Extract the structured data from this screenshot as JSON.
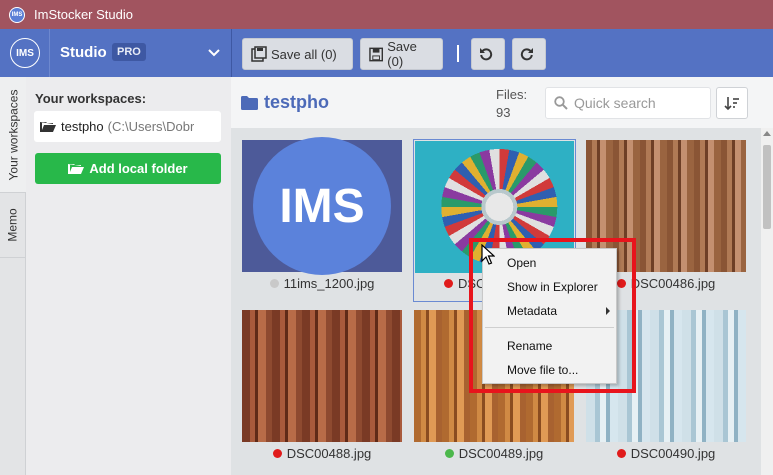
{
  "window": {
    "title": "ImStocker Studio",
    "logo_text": "IMS"
  },
  "header": {
    "logo_text": "IMS",
    "studio_label": "Studio",
    "pro_badge": "PRO",
    "save_all_label": "Save all (0)",
    "save_label": "Save (0)"
  },
  "vtabs": {
    "workspaces": "Your workspaces",
    "memo": "Memo"
  },
  "sidebar": {
    "heading": "Your workspaces:",
    "workspace": {
      "name": "testpho",
      "path": "(C:\\Users\\Dobr"
    },
    "add_folder_label": "Add local folder"
  },
  "main": {
    "folder_name": "testpho",
    "files_label": "Files:",
    "files_count": "93",
    "search_placeholder": "Quick search"
  },
  "tiles": [
    {
      "name": "11ims_1200.jpg",
      "dot": "#c9c9c9"
    },
    {
      "name": "DSC",
      "dot": "#e01b1b"
    },
    {
      "name": "DSC00486.jpg",
      "dot": "#e01b1b"
    },
    {
      "name": "DSC00488.jpg",
      "dot": "#e01b1b"
    },
    {
      "name": "DSC00489.jpg",
      "dot": "#4cb84c"
    },
    {
      "name": "DSC00490.jpg",
      "dot": "#e01b1b"
    }
  ],
  "context_menu": {
    "open": "Open",
    "show_in_explorer": "Show in Explorer",
    "metadata": "Metadata",
    "rename": "Rename",
    "move_file": "Move file to..."
  }
}
